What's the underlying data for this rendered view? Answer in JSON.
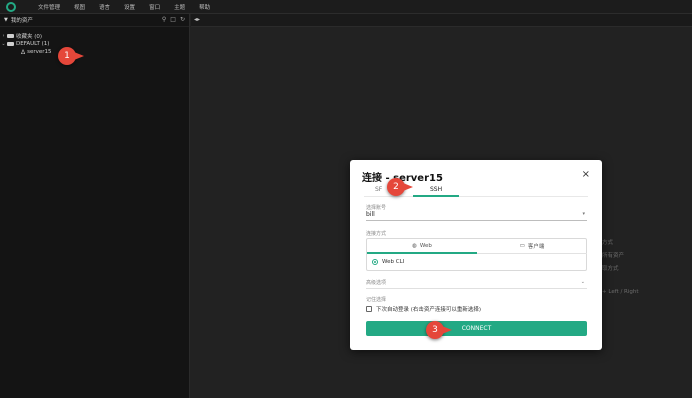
{
  "menubar": {
    "items": [
      "文件管理",
      "视图",
      "语言",
      "设置",
      "窗口",
      "主题",
      "帮助"
    ]
  },
  "sidebar": {
    "title": "我的资产",
    "tree": {
      "favorites": "收藏夹 (0)",
      "default_group": "DEFAULT (1)",
      "server": "server15"
    }
  },
  "main": {
    "hints": [
      "方式",
      "所有资产",
      "取方式",
      "+ Left / Right"
    ]
  },
  "annotations": [
    "1",
    "2",
    "3"
  ],
  "modal": {
    "title": "连接 - server15",
    "close": "×",
    "tabs": [
      "SF",
      "SSH"
    ],
    "account_label": "选择账号",
    "account_value": "bill",
    "method_label": "连接方式",
    "method_web": "Web",
    "method_client": "客户端",
    "web_cli": "Web CLI",
    "advanced_label": "高级选项",
    "remember_label": "记住选择",
    "remember_text": "下次自动登录 (右击资产连接可以重新选择)",
    "connect_label": "CONNECT"
  },
  "colors": {
    "accent": "#23a984",
    "annotation": "#e5473a"
  }
}
